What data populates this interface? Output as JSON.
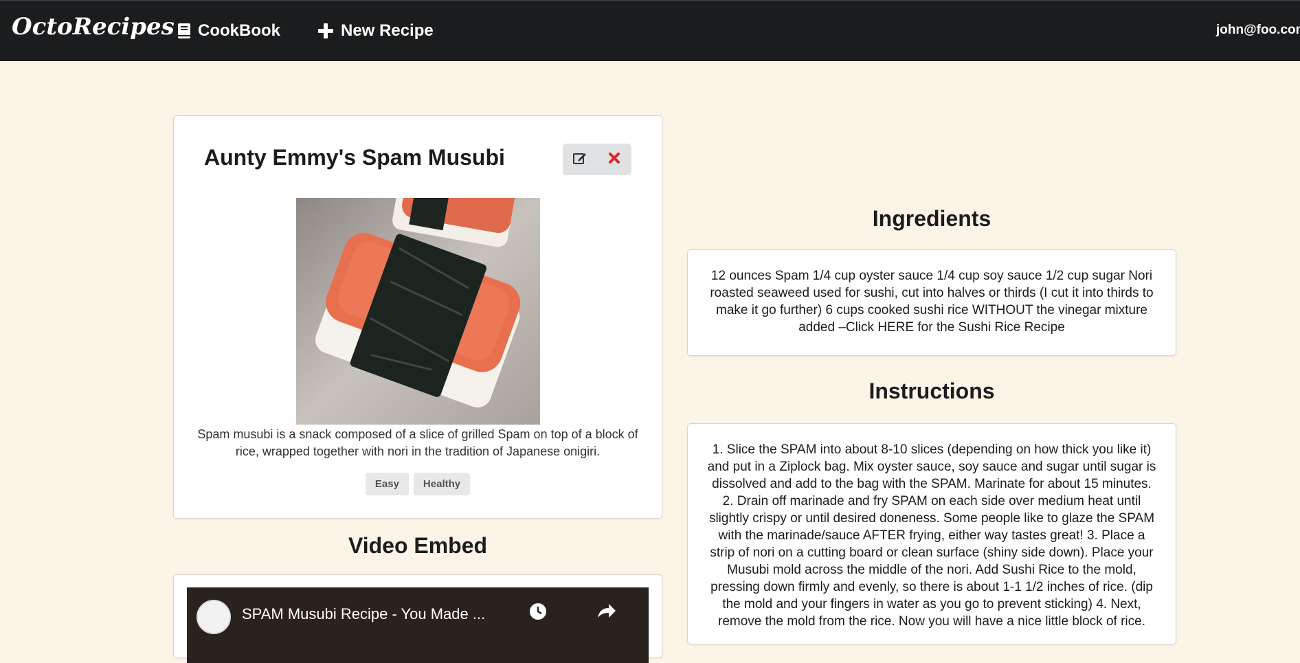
{
  "navbar": {
    "brand": "OctoRecipes",
    "cookbook_label": "CookBook",
    "new_recipe_label": "New Recipe",
    "user_email": "john@foo.com"
  },
  "recipe": {
    "title": "Aunty Emmy's Spam Musubi",
    "description": "Spam musubi is a snack composed of a slice of grilled Spam on top of a block of rice, wrapped together with nori in the tradition of Japanese onigiri.",
    "tags": [
      "Easy",
      "Healthy"
    ],
    "image_label": "Spam musubi photo"
  },
  "video": {
    "heading": "Video Embed",
    "title": "SPAM Musubi Recipe - You Made ..."
  },
  "ingredients": {
    "heading": "Ingredients",
    "text": "12 ounces Spam 1/4 cup oyster sauce 1/4 cup soy sauce 1/2 cup sugar Nori roasted seaweed used for sushi, cut into halves or thirds (I cut it into thirds to make it go further) 6 cups cooked sushi rice WITHOUT the vinegar mixture added –Click HERE for the Sushi Rice Recipe"
  },
  "instructions": {
    "heading": "Instructions",
    "text": "1. Slice the SPAM into about 8-10 slices (depending on how thick you like it) and put in a Ziplock bag. Mix oyster sauce, soy sauce and sugar until sugar is dissolved and add to the bag with the SPAM. Marinate for about 15 minutes. 2. Drain off marinade and fry SPAM on each side over medium heat until slightly crispy or until desired doneness. Some people like to glaze the SPAM with the marinade/sauce AFTER frying, either way tastes great! 3. Place a strip of nori on a cutting board or clean surface (shiny side down). Place your Musubi mold across the middle of the nori. Add Sushi Rice to the mold, pressing down firmly and evenly, so there is about 1-1 1/2 inches of rice. (dip the mold and your fingers in water as you go to prevent sticking) 4. Next, remove the mold from the rice. Now you will have a nice little block of rice."
  },
  "colors": {
    "background": "#fcf4e7",
    "navbar": "#1b1c1d",
    "delete_red": "#db2828"
  },
  "icons": [
    "book-icon",
    "plus-icon",
    "edit-icon",
    "close-icon",
    "clock-icon",
    "share-icon"
  ]
}
